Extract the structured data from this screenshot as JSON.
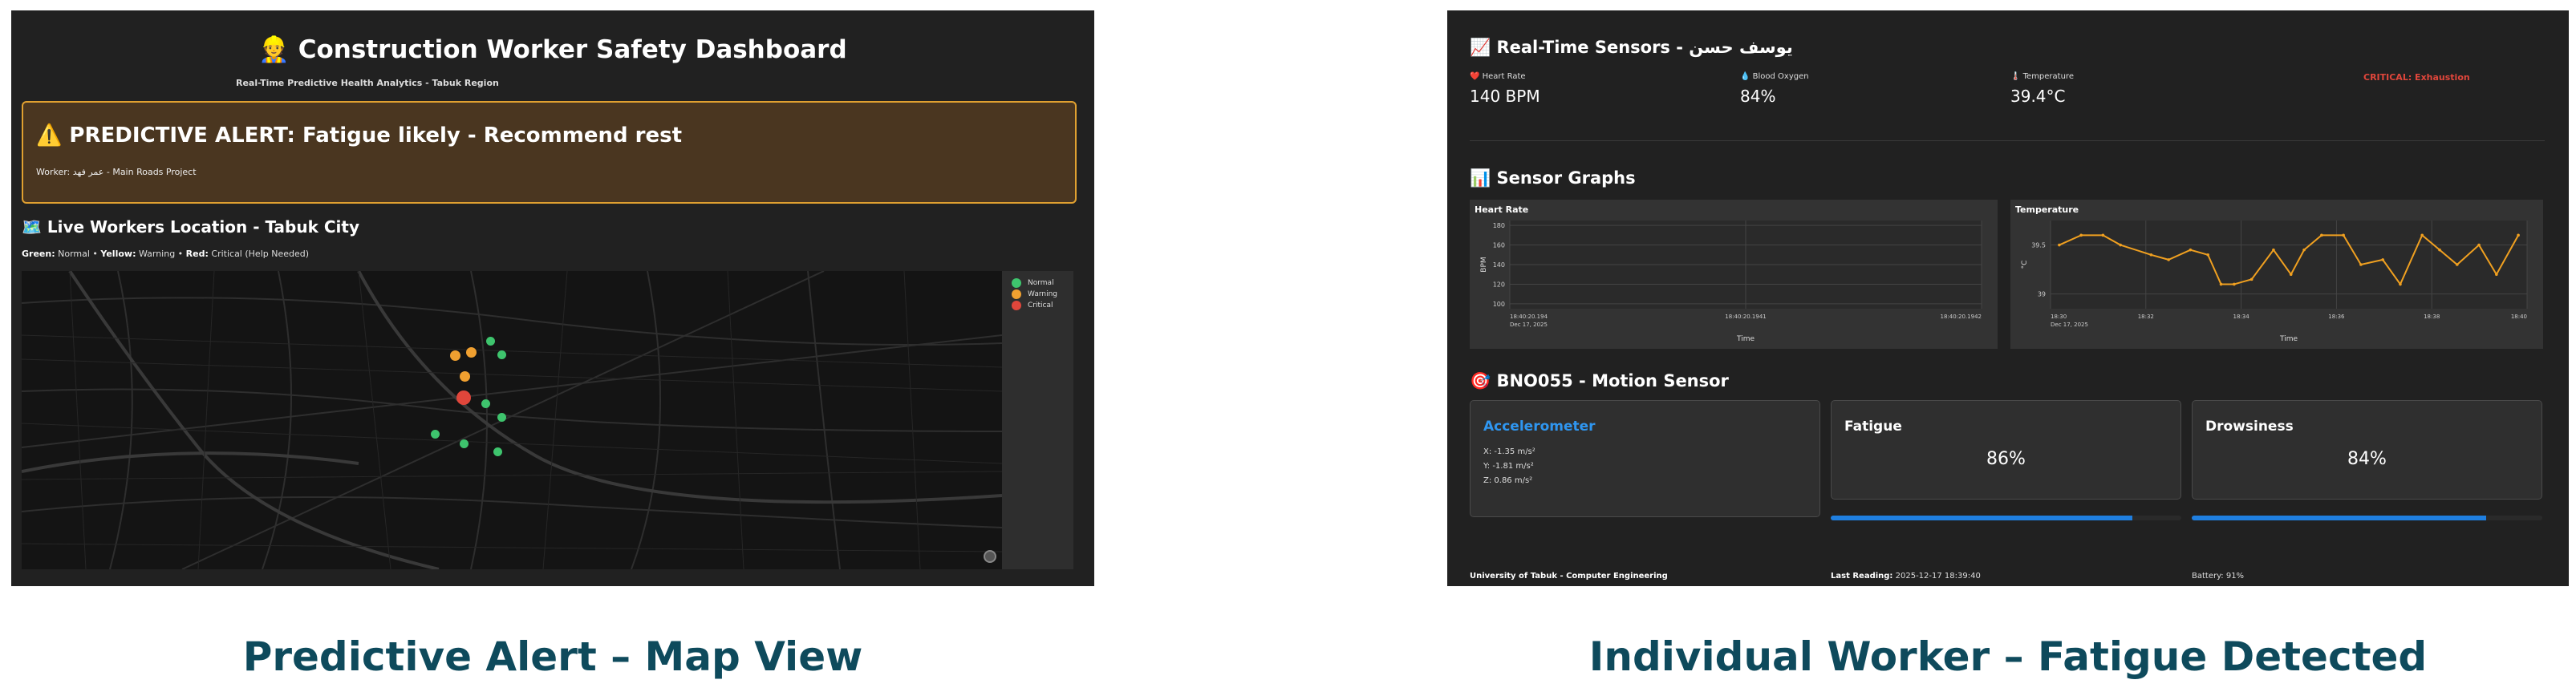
{
  "left": {
    "title": "👷 Construction Worker Safety Dashboard",
    "subtitle": "Real-Time Predictive Health Analytics - Tabuk Region",
    "alert": {
      "title": "⚠️ PREDICTIVE ALERT: Fatigue likely - Recommend rest",
      "worker": "Worker: عمر فهد - Main Roads Project",
      "bg_color": "#4a3620",
      "border_color": "#e0a030"
    },
    "map_section_title": "🗺️ Live Workers Location - Tabuk City",
    "legend_line": {
      "green_key": "Green:",
      "green_val": " Normal • ",
      "yellow_key": "Yellow:",
      "yellow_val": " Warning • ",
      "red_key": "Red:",
      "red_val": " Critical (Help Needed)"
    },
    "map_legend": [
      {
        "label": "Normal",
        "color": "#3ec46d"
      },
      {
        "label": "Warning",
        "color": "#f0a030"
      },
      {
        "label": "Critical",
        "color": "#e0463b"
      }
    ],
    "compass_icon": "compass-icon"
  },
  "right": {
    "title": "📈 Real-Time Sensors - يوسف حسن",
    "metrics": [
      {
        "label": "❤️ Heart Rate",
        "value": "140 BPM"
      },
      {
        "label": "💧 Blood Oxygen",
        "value": "84%"
      },
      {
        "label": "🌡️ Temperature",
        "value": "39.4°C"
      }
    ],
    "status": "CRITICAL: Exhaustion",
    "status_color": "#e0463b",
    "graphs_title": "📊 Sensor Graphs",
    "motion_title": "🎯 BNO055 - Motion Sensor",
    "accelerometer": {
      "title": "Accelerometer",
      "x": "X: -1.35 m/s²",
      "y": "Y: -1.81 m/s²",
      "z": "Z: 0.86 m/s²"
    },
    "fatigue": {
      "title": "Fatigue",
      "value": "86%",
      "level": 0.86
    },
    "drowsiness": {
      "title": "Drowsiness",
      "value": "84%",
      "level": 0.84
    },
    "footer": {
      "org": "University of Tabuk - Computer Engineering",
      "last_label": "Last Reading:",
      "last_value": " 2025-12-17 18:39:40",
      "battery": "Battery: 91%"
    },
    "accent_color": "#1f7fe0"
  },
  "captions": {
    "left": "Predictive Alert – Map View",
    "right": "Individual Worker – Fatigue Detected"
  },
  "chart_data": [
    {
      "type": "line",
      "title": "Heart Rate",
      "xlabel": "Time",
      "ylabel": "BPM",
      "x_ticks": [
        "18:40:20.194\nDec 17, 2025",
        "18:40:20.1941",
        "18:40:20.1942"
      ],
      "y_ticks": [
        100,
        120,
        140,
        160,
        180
      ],
      "ylim": [
        95,
        185
      ],
      "series": [
        {
          "x": [],
          "y": []
        }
      ],
      "grid": true
    },
    {
      "type": "line",
      "title": "Temperature",
      "xlabel": "Time",
      "ylabel": "°C",
      "x_ticks": [
        "18:30\nDec 17, 2025",
        "18:32",
        "18:34",
        "18:36",
        "18:38",
        "18:40"
      ],
      "y_ticks": [
        39,
        39.5
      ],
      "ylim": [
        38.85,
        39.75
      ],
      "series": [
        {
          "color": "#f0a020",
          "x": [
            0.2,
            0.7,
            1.2,
            1.6,
            2.3,
            2.7,
            3.2,
            3.6,
            3.9,
            4.2,
            4.6,
            5.1,
            5.5,
            5.8,
            6.2,
            6.7,
            7.1,
            7.6,
            8.0,
            8.5,
            8.9,
            9.3,
            9.8,
            10.2,
            10.7
          ],
          "y": [
            39.5,
            39.6,
            39.6,
            39.5,
            39.4,
            39.35,
            39.45,
            39.4,
            39.1,
            39.1,
            39.15,
            39.45,
            39.2,
            39.45,
            39.6,
            39.6,
            39.3,
            39.35,
            39.1,
            39.6,
            39.45,
            39.3,
            39.5,
            39.2,
            39.6
          ]
        }
      ],
      "grid": true
    }
  ]
}
